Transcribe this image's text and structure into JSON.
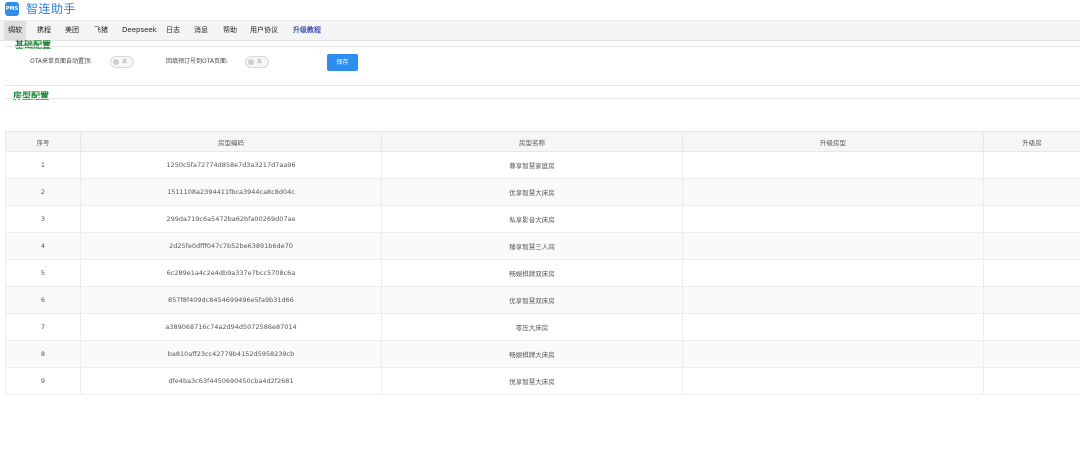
{
  "header": {
    "logo_text": "PMS",
    "app_title": "智连助手"
  },
  "nav": [
    {
      "label": "绸软",
      "active": true
    },
    {
      "label": "携程"
    },
    {
      "label": "美团"
    },
    {
      "label": "飞猪"
    },
    {
      "label": "Deepseek"
    },
    {
      "label": "日志"
    },
    {
      "label": "消息"
    },
    {
      "label": "帮助"
    },
    {
      "label": "用户协议"
    },
    {
      "label": "升级教程",
      "special": true
    }
  ],
  "basic": {
    "title": "基础配置",
    "field1_label": "OTA来单页面自动置顶:",
    "field1_toggle": "关",
    "field2_label": "回填预订号到OTA页面:",
    "field2_toggle": "关",
    "save": "保存"
  },
  "room": {
    "title": "房型配置",
    "columns": [
      "序号",
      "房型编码",
      "房型名称",
      "升级房型",
      "升级房"
    ],
    "rows": [
      [
        "1",
        "1250c5fa72774d858e7d3a3217d7aa96",
        "尊享智慧家庭房",
        "",
        ""
      ],
      [
        "2",
        "1511108a2394411fbca3944ca8c8d04c",
        "优享智慧大床房",
        "",
        ""
      ],
      [
        "3",
        "299da719c6a5472ba62bfa00269d07ae",
        "私享影音大床房",
        "",
        ""
      ],
      [
        "4",
        "2d25fe0dfff047c7b52be63891b6de70",
        "臻享智慧三人间",
        "",
        ""
      ],
      [
        "5",
        "6c289e1a4c2e4db9a337e7bcc5708c6a",
        "畅娱棋牌双床房",
        "",
        ""
      ],
      [
        "6",
        "857f8f409dc8454699496e5fa9b31d66",
        "优享智慧双床房",
        "",
        ""
      ],
      [
        "7",
        "a389068716c74a2d94d5072586e87014",
        "零压大床房",
        "",
        ""
      ],
      [
        "8",
        "ba810aff23cc42779b4152d5958239cb",
        "畅娱棋牌大床房",
        "",
        ""
      ],
      [
        "9",
        "dfe4ba3c63f4450690450cba4d2f2681",
        "悦享智慧大床房",
        "",
        ""
      ]
    ]
  }
}
